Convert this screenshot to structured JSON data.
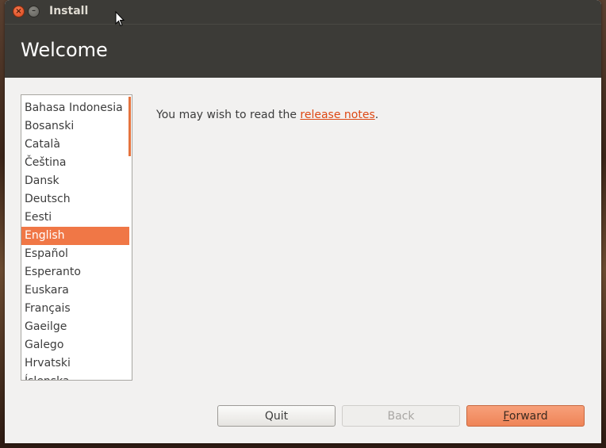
{
  "window": {
    "title": "Install"
  },
  "header": {
    "title": "Welcome"
  },
  "languages": [
    "Bahasa Indonesia",
    "Bosanski",
    "Català",
    "Čeština",
    "Dansk",
    "Deutsch",
    "Eesti",
    "English",
    "Español",
    "Esperanto",
    "Euskara",
    "Français",
    "Gaeilge",
    "Galego",
    "Hrvatski",
    "Íslenska"
  ],
  "selected_language": "English",
  "notes": {
    "prefix": "You may wish to read the ",
    "link": "release notes",
    "suffix": "."
  },
  "buttons": {
    "quit": "Quit",
    "back": "Back",
    "forward_accel": "F",
    "forward_rest": "orward"
  },
  "colors": {
    "accent": "#f07746",
    "link": "#dd4814",
    "header_bg": "#3c3b37"
  }
}
